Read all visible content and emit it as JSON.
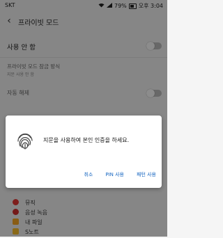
{
  "status_bar": {
    "carrier": "SKT",
    "battery": "79%",
    "time": "오후 3:04"
  },
  "app_bar": {
    "title": "프라이빗 모드"
  },
  "settings": {
    "use_label": "사용 안 함",
    "access_label": "프라이빗 모드 잠금 방식",
    "access_value": "지문 사용 안 함",
    "auto_off_label": "자동 해제"
  },
  "apps": [
    {
      "name": "뮤직",
      "color": "#e53935"
    },
    {
      "name": "음성 녹음",
      "color": "#d32f2f"
    },
    {
      "name": "내 파일",
      "color": "#f9a825"
    },
    {
      "name": "S노트",
      "color": "#fbc02d"
    }
  ],
  "dialog": {
    "message": "지문을 사용하여 본인 인증을 하세요.",
    "cancel": "취소",
    "pin": "PIN 사용",
    "pattern": "패턴 사용"
  }
}
